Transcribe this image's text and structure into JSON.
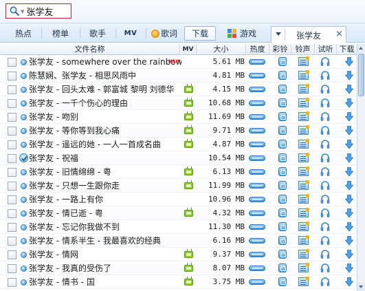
{
  "search": {
    "query": "张学友"
  },
  "tabs": [
    {
      "label": "热点"
    },
    {
      "label": "榜单"
    },
    {
      "label": "歌手"
    },
    {
      "label": "MV"
    },
    {
      "label": "歌词"
    },
    {
      "label": "下载"
    },
    {
      "label": "游戏"
    }
  ],
  "search_tab": {
    "label": "张学友",
    "close": "×"
  },
  "columns": {
    "file_name": "文件名称",
    "mv": "MV",
    "size": "大小",
    "heat": "热度",
    "ringtone": "彩铃",
    "tone": "铃声",
    "listen": "试听",
    "download": "下载"
  },
  "new_badge": "NEW",
  "rows": [
    {
      "title": "张学友 - somewhere over the rainbow",
      "size": "5.61 MB",
      "has_mv": false,
      "is_new": true,
      "checked": false
    },
    {
      "title": "陈慧娴、张学友 - 相思风雨中",
      "size": "4.81 MB",
      "has_mv": false,
      "is_new": false,
      "checked": false
    },
    {
      "title": "张学友 - 回头太难 - 郭富城 黎明 刘德华",
      "size": "4.15 MB",
      "has_mv": true,
      "is_new": false,
      "checked": false
    },
    {
      "title": "张学友 - 一千个伤心的理由",
      "size": "10.68 MB",
      "has_mv": true,
      "is_new": false,
      "checked": false
    },
    {
      "title": "张学友 - 吻别",
      "size": "11.69 MB",
      "has_mv": true,
      "is_new": false,
      "checked": false
    },
    {
      "title": "张学友 - 等你等到我心痛",
      "size": "9.71 MB",
      "has_mv": true,
      "is_new": false,
      "checked": false
    },
    {
      "title": "张学友 - 遥远的她 - 一人一首成名曲",
      "size": "4.87 MB",
      "has_mv": true,
      "is_new": false,
      "checked": false
    },
    {
      "title": "张学友 - 祝福",
      "size": "10.54 MB",
      "has_mv": false,
      "is_new": false,
      "checked": true
    },
    {
      "title": "张学友 - 旧情绵绵 - 粤",
      "size": "6.13 MB",
      "has_mv": true,
      "is_new": false,
      "checked": false
    },
    {
      "title": "张学友 - 只想一生跟你走",
      "size": "11.99 MB",
      "has_mv": true,
      "is_new": false,
      "checked": false
    },
    {
      "title": "张学友 - 一路上有你",
      "size": "10.96 MB",
      "has_mv": false,
      "is_new": false,
      "checked": false
    },
    {
      "title": "张学友 - 情已逝 - 粤",
      "size": "4.32 MB",
      "has_mv": true,
      "is_new": false,
      "checked": false
    },
    {
      "title": "张学友 - 忘记你我做不到",
      "size": "11.30 MB",
      "has_mv": false,
      "is_new": false,
      "checked": false
    },
    {
      "title": "张学友 - 情系半生 - 我最喜欢的经典",
      "size": "6.16 MB",
      "has_mv": false,
      "is_new": false,
      "checked": false
    },
    {
      "title": "张学友 - 情网",
      "size": "9.37 MB",
      "has_mv": true,
      "is_new": false,
      "checked": false
    },
    {
      "title": "张学友 - 我真的受伤了",
      "size": "8.07 MB",
      "has_mv": true,
      "is_new": false,
      "checked": false
    },
    {
      "title": "张学友 - 情书 - 国",
      "size": "3.75 MB",
      "has_mv": true,
      "is_new": false,
      "checked": false
    }
  ],
  "colors": {
    "accent": "#3a8fd8",
    "search_border": "#cc1f2b",
    "new_badge": "#e32020",
    "mv_icon": "#8fc93a"
  }
}
